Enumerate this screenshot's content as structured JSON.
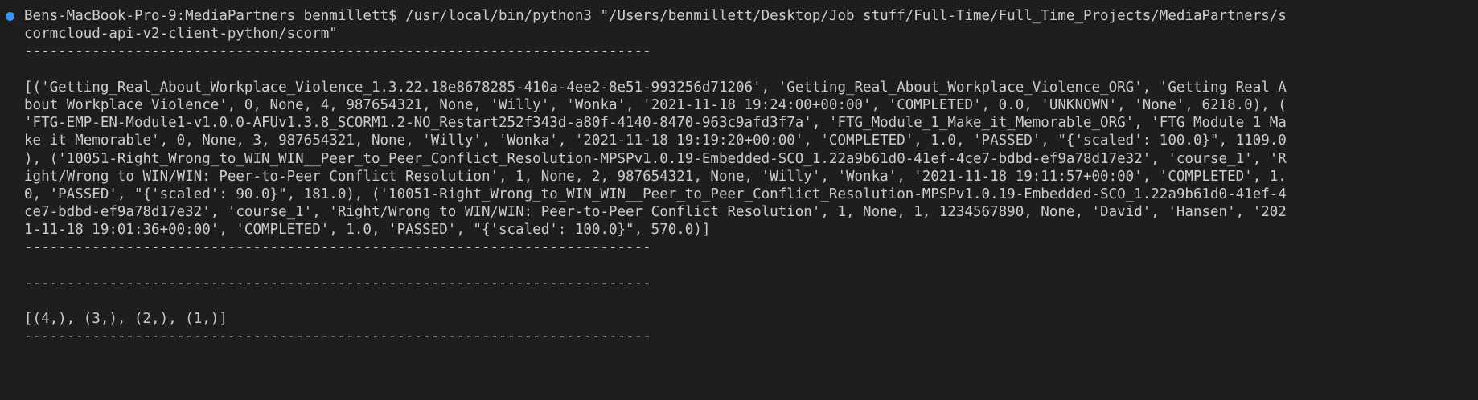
{
  "terminal": {
    "lines": [
      "Bens-MacBook-Pro-9:MediaPartners benmillett$ /usr/local/bin/python3 \"/Users/benmillett/Desktop/Job stuff/Full-Time/Full_Time_Projects/MediaPartners/s",
      "cormcloud-api-v2-client-python/scorm\"",
      "--------------------------------------------------------------------------",
      "",
      "[('Getting_Real_About_Workplace_Violence_1.3.22.18e8678285-410a-4ee2-8e51-993256d71206', 'Getting_Real_About_Workplace_Violence_ORG', 'Getting Real A",
      "bout Workplace Violence', 0, None, 4, 987654321, None, 'Willy', 'Wonka', '2021-11-18 19:24:00+00:00', 'COMPLETED', 0.0, 'UNKNOWN', 'None', 6218.0), (",
      "'FTG-EMP-EN-Module1-v1.0.0-AFUv1.3.8_SCORM1.2-NO_Restart252f343d-a80f-4140-8470-963c9afd3f7a', 'FTG_Module_1_Make_it_Memorable_ORG', 'FTG Module 1 Ma",
      "ke it Memorable', 0, None, 3, 987654321, None, 'Willy', 'Wonka', '2021-11-18 19:19:20+00:00', 'COMPLETED', 1.0, 'PASSED', \"{'scaled': 100.0}\", 1109.0",
      "), ('10051-Right_Wrong_to_WIN_WIN__Peer_to_Peer_Conflict_Resolution-MPSPv1.0.19-Embedded-SCO_1.22a9b61d0-41ef-4ce7-bdbd-ef9a78d17e32', 'course_1', 'R",
      "ight/Wrong to WIN/WIN: Peer-to-Peer Conflict Resolution', 1, None, 2, 987654321, None, 'Willy', 'Wonka', '2021-11-18 19:11:57+00:00', 'COMPLETED', 1.",
      "0, 'PASSED', \"{'scaled': 90.0}\", 181.0), ('10051-Right_Wrong_to_WIN_WIN__Peer_to_Peer_Conflict_Resolution-MPSPv1.0.19-Embedded-SCO_1.22a9b61d0-41ef-4",
      "ce7-bdbd-ef9a78d17e32', 'course_1', 'Right/Wrong to WIN/WIN: Peer-to-Peer Conflict Resolution', 1, None, 1, 1234567890, None, 'David', 'Hansen', '202",
      "1-11-18 19:01:36+00:00', 'COMPLETED', 1.0, 'PASSED', \"{'scaled': 100.0}\", 570.0)]",
      "--------------------------------------------------------------------------",
      "",
      "--------------------------------------------------------------------------",
      "",
      "[(4,), (3,), (2,), (1,)]",
      "--------------------------------------------------------------------------"
    ]
  },
  "colors": {
    "background": "#1e1e1e",
    "text": "#cccccc",
    "status_dot": "#3794ff"
  }
}
